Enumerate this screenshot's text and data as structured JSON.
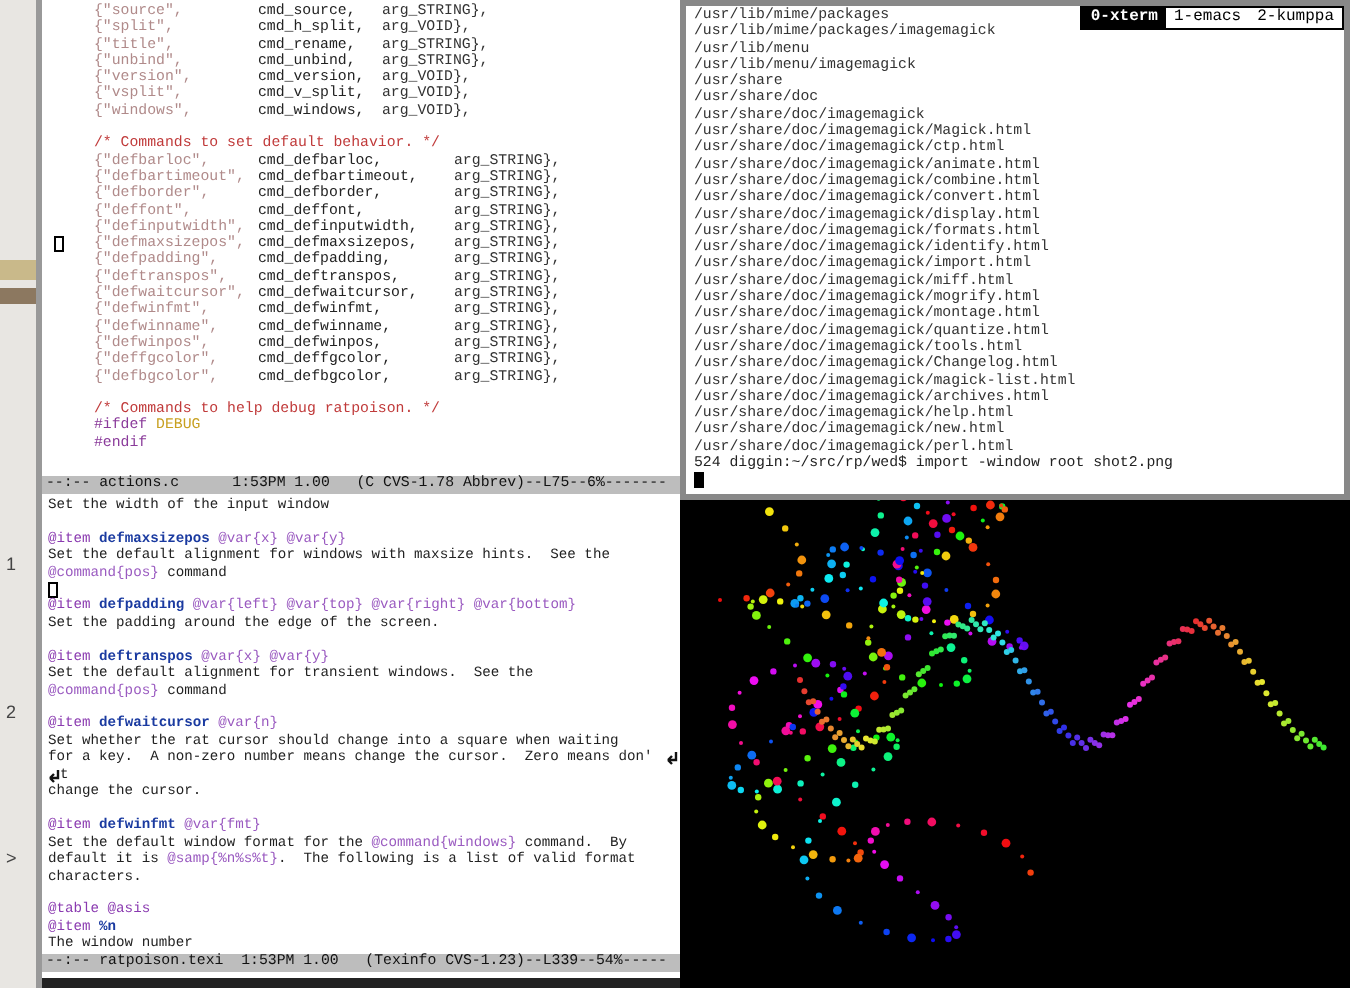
{
  "background_window": {
    "texts": [
      "1",
      "2",
      ">"
    ]
  },
  "emacs": {
    "code_buffer": {
      "lines": [
        {
          "kind": "entry",
          "name": "{\"source\",",
          "fn": "cmd_source,",
          "arg": "arg_STRING},"
        },
        {
          "kind": "entry",
          "name": "{\"split\",",
          "fn": "cmd_h_split,",
          "arg": "arg_VOID},"
        },
        {
          "kind": "entry",
          "name": "{\"title\",",
          "fn": "cmd_rename,",
          "arg": "arg_STRING},"
        },
        {
          "kind": "entry",
          "name": "{\"unbind\",",
          "fn": "cmd_unbind,",
          "arg": "arg_STRING},"
        },
        {
          "kind": "entry",
          "name": "{\"version\",",
          "fn": "cmd_version,",
          "arg": "arg_VOID},"
        },
        {
          "kind": "entry",
          "name": "{\"vsplit\",",
          "fn": "cmd_v_split,",
          "arg": "arg_VOID},"
        },
        {
          "kind": "entry",
          "name": "{\"windows\",",
          "fn": "cmd_windows,",
          "arg": "arg_VOID},"
        },
        {
          "kind": "blank"
        },
        {
          "kind": "comment",
          "text": "/* Commands to set default behavior. */"
        },
        {
          "kind": "entry2",
          "name": "{\"defbarloc\",",
          "fn": "cmd_defbarloc,",
          "arg": "arg_STRING},"
        },
        {
          "kind": "entry2",
          "name": "{\"defbartimeout\",",
          "fn": "cmd_defbartimeout,",
          "arg": "arg_STRING},"
        },
        {
          "kind": "entry2",
          "name": "{\"defborder\",",
          "fn": "cmd_defborder,",
          "arg": "arg_STRING},"
        },
        {
          "kind": "entry2",
          "name": "{\"deffont\",",
          "fn": "cmd_deffont,",
          "arg": "arg_STRING},"
        },
        {
          "kind": "entry2",
          "name": "{\"definputwidth\",",
          "fn": "cmd_definputwidth,",
          "arg": "arg_STRING},"
        },
        {
          "kind": "entry2",
          "name": "{\"defmaxsizepos\",",
          "fn": "cmd_defmaxsizepos,",
          "arg": "arg_STRING},",
          "cursor": true
        },
        {
          "kind": "entry2",
          "name": "{\"defpadding\",",
          "fn": "cmd_defpadding,",
          "arg": "arg_STRING},"
        },
        {
          "kind": "entry2",
          "name": "{\"deftranspos\",",
          "fn": "cmd_deftranspos,",
          "arg": "arg_STRING},"
        },
        {
          "kind": "entry2",
          "name": "{\"defwaitcursor\",",
          "fn": "cmd_defwaitcursor,",
          "arg": "arg_STRING},"
        },
        {
          "kind": "entry2",
          "name": "{\"defwinfmt\",",
          "fn": "cmd_defwinfmt,",
          "arg": "arg_STRING},"
        },
        {
          "kind": "entry2",
          "name": "{\"defwinname\",",
          "fn": "cmd_defwinname,",
          "arg": "arg_STRING},"
        },
        {
          "kind": "entry2",
          "name": "{\"defwinpos\",",
          "fn": "cmd_defwinpos,",
          "arg": "arg_STRING},"
        },
        {
          "kind": "entry2",
          "name": "{\"deffgcolor\",",
          "fn": "cmd_deffgcolor,",
          "arg": "arg_STRING},"
        },
        {
          "kind": "entry2",
          "name": "{\"defbgcolor\",",
          "fn": "cmd_defbgcolor,",
          "arg": "arg_STRING},"
        },
        {
          "kind": "blank"
        },
        {
          "kind": "comment",
          "text": "/* Commands to help debug ratpoison. */"
        },
        {
          "kind": "preproc",
          "directive": "#ifdef",
          "arg": "DEBUG"
        },
        {
          "kind": "preproc",
          "directive": "#endif"
        }
      ]
    },
    "code_modeline": "--:-- actions.c      1:53PM 1.00   (C CVS-1.78 Abbrev)--L75--6%-------",
    "texi_buffer": {
      "lines": [
        {
          "parts": [
            {
              "kind": "plain",
              "text": "Set the width of the input window"
            }
          ]
        },
        {
          "kind": "blank"
        },
        {
          "parts": [
            {
              "kind": "cmd",
              "text": "@item"
            },
            {
              "kind": "name",
              "text": " defmaxsizepos"
            },
            {
              "kind": "var",
              "text": " @var{x}"
            },
            {
              "kind": "var",
              "text": " @var{y}"
            }
          ]
        },
        {
          "parts": [
            {
              "kind": "plain",
              "text": "Set the default alignment for windows with maxsize hints.  See the"
            }
          ]
        },
        {
          "parts": [
            {
              "kind": "var",
              "text": "@command{pos}"
            },
            {
              "kind": "plain",
              "text": " command"
            }
          ]
        },
        {
          "cursor": true
        },
        {
          "parts": [
            {
              "kind": "cmd",
              "text": "@item"
            },
            {
              "kind": "name",
              "text": " defpadding"
            },
            {
              "kind": "var",
              "text": " @var{left}"
            },
            {
              "kind": "var",
              "text": " @var{top}"
            },
            {
              "kind": "var",
              "text": " @var{right}"
            },
            {
              "kind": "var",
              "text": " @var{bottom}"
            }
          ]
        },
        {
          "parts": [
            {
              "kind": "plain",
              "text": "Set the padding around the edge of the screen."
            }
          ]
        },
        {
          "kind": "blank"
        },
        {
          "parts": [
            {
              "kind": "cmd",
              "text": "@item"
            },
            {
              "kind": "name",
              "text": " deftranspos"
            },
            {
              "kind": "var",
              "text": " @var{x}"
            },
            {
              "kind": "var",
              "text": " @var{y}"
            }
          ]
        },
        {
          "parts": [
            {
              "kind": "plain",
              "text": "Set the default alignment for transient windows.  See the"
            }
          ]
        },
        {
          "parts": [
            {
              "kind": "var",
              "text": "@command{pos}"
            },
            {
              "kind": "plain",
              "text": " command"
            }
          ]
        },
        {
          "kind": "blank"
        },
        {
          "parts": [
            {
              "kind": "cmd",
              "text": "@item"
            },
            {
              "kind": "name",
              "text": " defwaitcursor"
            },
            {
              "kind": "var",
              "text": " @var{n}"
            }
          ]
        },
        {
          "parts": [
            {
              "kind": "plain",
              "text": "Set whether the rat cursor should change into a square when waiting"
            }
          ]
        },
        {
          "parts": [
            {
              "kind": "plain",
              "text": "for a key.  A non-zero number means change the cursor.  Zero means don'"
            }
          ],
          "wrap": true
        },
        {
          "parts": [
            {
              "kind": "plain",
              "text": "t"
            }
          ],
          "continued": true
        },
        {
          "parts": [
            {
              "kind": "plain",
              "text": "change the cursor."
            }
          ]
        },
        {
          "kind": "blank"
        },
        {
          "parts": [
            {
              "kind": "cmd",
              "text": "@item"
            },
            {
              "kind": "name",
              "text": " defwinfmt"
            },
            {
              "kind": "var",
              "text": " @var{fmt}"
            }
          ]
        },
        {
          "parts": [
            {
              "kind": "plain",
              "text": "Set the default window format for the "
            },
            {
              "kind": "var",
              "text": "@command{windows}"
            },
            {
              "kind": "plain",
              "text": " command.  By"
            }
          ]
        },
        {
          "parts": [
            {
              "kind": "plain",
              "text": "default it is "
            },
            {
              "kind": "var",
              "text": "@samp{%n%s%t}"
            },
            {
              "kind": "plain",
              "text": ".  The following is a list of valid format"
            }
          ]
        },
        {
          "parts": [
            {
              "kind": "plain",
              "text": "characters."
            }
          ]
        },
        {
          "kind": "blank"
        },
        {
          "parts": [
            {
              "kind": "cmd",
              "text": "@table @asis"
            }
          ]
        },
        {
          "parts": [
            {
              "kind": "cmd",
              "text": "@item"
            },
            {
              "kind": "name",
              "text": " %n"
            }
          ]
        },
        {
          "parts": [
            {
              "kind": "plain",
              "text": "The window number"
            }
          ]
        }
      ]
    },
    "texi_modeline": "--:-- ratpoison.texi  1:53PM 1.00   (Texinfo CVS-1.23)--L339--54%-----"
  },
  "window_bar": [
    {
      "label": "0-xterm",
      "selected": true
    },
    {
      "label": "1-emacs",
      "selected": false
    },
    {
      "label": "2-kumppa",
      "selected": false
    }
  ],
  "xterm": {
    "lines": [
      "/usr/lib/mime/packages",
      "/usr/lib/mime/packages/imagemagick",
      "/usr/lib/menu",
      "/usr/lib/menu/imagemagick",
      "/usr/share",
      "/usr/share/doc",
      "/usr/share/doc/imagemagick",
      "/usr/share/doc/imagemagick/Magick.html",
      "/usr/share/doc/imagemagick/ctp.html",
      "/usr/share/doc/imagemagick/animate.html",
      "/usr/share/doc/imagemagick/combine.html",
      "/usr/share/doc/imagemagick/convert.html",
      "/usr/share/doc/imagemagick/display.html",
      "/usr/share/doc/imagemagick/formats.html",
      "/usr/share/doc/imagemagick/identify.html",
      "/usr/share/doc/imagemagick/import.html",
      "/usr/share/doc/imagemagick/miff.html",
      "/usr/share/doc/imagemagick/mogrify.html",
      "/usr/share/doc/imagemagick/montage.html",
      "/usr/share/doc/imagemagick/quantize.html",
      "/usr/share/doc/imagemagick/tools.html",
      "/usr/share/doc/imagemagick/Changelog.html",
      "/usr/share/doc/imagemagick/magick-list.html",
      "/usr/share/doc/imagemagick/archives.html",
      "/usr/share/doc/imagemagick/help.html",
      "/usr/share/doc/imagemagick/new.html",
      "/usr/share/doc/imagemagick/perl.html"
    ],
    "prompt": "524 diggin:~/src/rp/wed$ import -window root shot2.png"
  }
}
